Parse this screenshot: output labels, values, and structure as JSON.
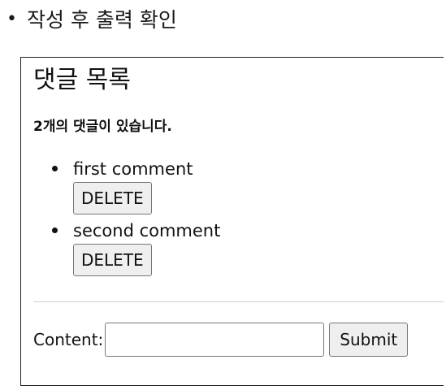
{
  "section": {
    "bullet": "•",
    "heading": "작성 후 출력 확인"
  },
  "panel": {
    "title": "댓글 목록",
    "count_text": "2개의 댓글이 있습니다.",
    "comments": [
      {
        "text": "first comment",
        "delete_label": "DELETE"
      },
      {
        "text": "second comment",
        "delete_label": "DELETE"
      }
    ],
    "form": {
      "content_label": "Content:",
      "content_value": "",
      "submit_label": "Submit"
    }
  }
}
